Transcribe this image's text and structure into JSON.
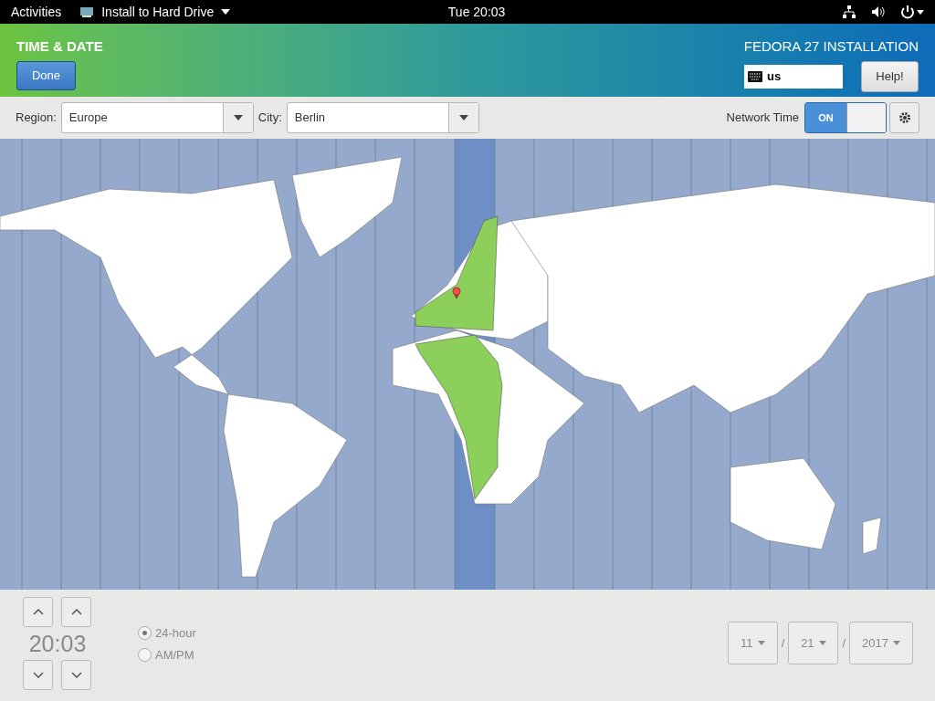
{
  "top_bar": {
    "activities": "Activities",
    "app_menu": "Install to Hard Drive",
    "clock": "Tue 20:03"
  },
  "header": {
    "title": "TIME & DATE",
    "done_button": "Done",
    "product": "FEDORA 27 INSTALLATION",
    "keyboard_layout": "us",
    "help_button": "Help!"
  },
  "toolbar": {
    "region_label": "Region:",
    "region": "Europe",
    "city_label": "City:",
    "city": "Berlin",
    "network_time_label": "Network Time",
    "network_time": {
      "label": "ON",
      "on": true
    }
  },
  "time": {
    "value": "20:03"
  },
  "time_format": [
    {
      "label": "24-hour",
      "selected": true
    },
    {
      "label": "AM/PM",
      "selected": false
    }
  ],
  "date": {
    "month": "11",
    "day": "21",
    "year": "2017",
    "separators": [
      "/",
      "/"
    ]
  }
}
